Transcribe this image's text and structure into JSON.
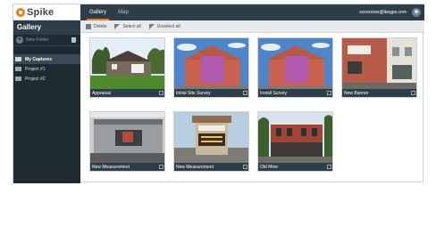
{
  "app": {
    "logo_text": "Spike"
  },
  "sidebar": {
    "title": "Gallery",
    "new_folder": "New Folder",
    "folders": [
      {
        "label": "My Captures",
        "selected": true
      },
      {
        "label": "Project #1",
        "selected": false
      },
      {
        "label": "Project #2",
        "selected": false
      }
    ]
  },
  "topbar": {
    "tabs": [
      {
        "label": "Gallery"
      },
      {
        "label": "Map"
      }
    ],
    "user_email": "xxxxxxxxx@ikegps.com"
  },
  "toolbar": {
    "delete_label": "Delete",
    "select_all_label": "Select all",
    "unselect_all_label": "Unselect all"
  },
  "gallery": [
    {
      "caption": "Appraisal",
      "scene": "house"
    },
    {
      "caption": "Initial Site Survey",
      "scene": "pink-building"
    },
    {
      "caption": "Install Survey",
      "scene": "pink-building"
    },
    {
      "caption": "New Banner",
      "scene": "storefront"
    },
    {
      "caption": "New Measurement",
      "scene": "grey-building"
    },
    {
      "caption": "New Measurement",
      "scene": "sign"
    },
    {
      "caption": "Old Mine",
      "scene": "brick-building"
    }
  ],
  "colors": {
    "accent": "#f07a1e",
    "sidebar": "#1e2b33",
    "bar": "#2e3e48"
  }
}
